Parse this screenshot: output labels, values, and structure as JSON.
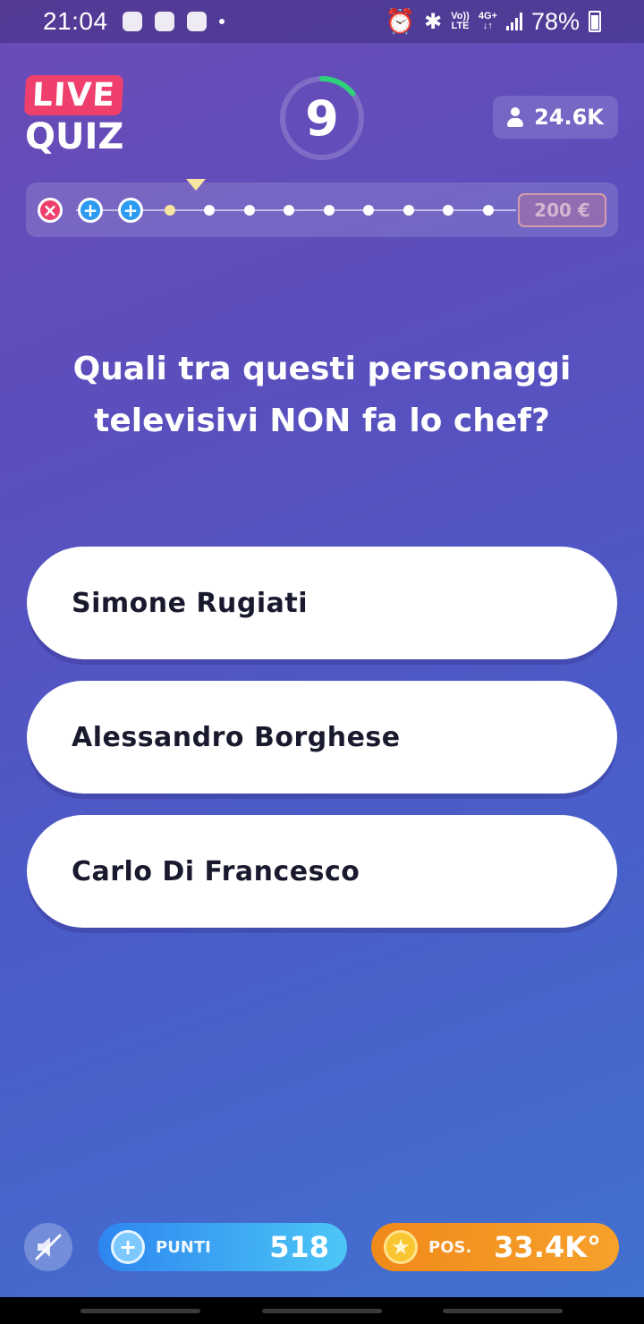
{
  "status_bar": {
    "time": "21:04",
    "volte_top": "Vo))",
    "volte_bottom": "LTE",
    "network_top": "4G+",
    "network_bottom": "↓↑",
    "battery": "78%"
  },
  "header": {
    "logo_live": "LIVE",
    "logo_quiz": "QUIZ",
    "timer_value": "9",
    "viewers": "24.6K"
  },
  "progress": {
    "prize": "200 €",
    "steps": [
      {
        "state": "wrong",
        "glyph": "×"
      },
      {
        "state": "extra-life",
        "glyph": "+"
      },
      {
        "state": "extra-life",
        "glyph": "+"
      },
      {
        "state": "current"
      },
      {
        "state": "pending"
      },
      {
        "state": "pending"
      },
      {
        "state": "pending"
      },
      {
        "state": "pending"
      },
      {
        "state": "pending"
      },
      {
        "state": "pending"
      },
      {
        "state": "pending"
      },
      {
        "state": "pending"
      }
    ]
  },
  "question": {
    "line1": "Quali tra questi personaggi",
    "line2": "televisivi NON fa lo chef?"
  },
  "answers": [
    {
      "label": "Simone Rugiati"
    },
    {
      "label": "Alessandro Borghese"
    },
    {
      "label": "Carlo Di Francesco"
    }
  ],
  "footer": {
    "points_label": "PUNTI",
    "points_value": "518",
    "position_label": "POS.",
    "position_value": "33.4K°"
  },
  "colors": {
    "accent_pink": "#ef3f6d",
    "timer_green": "#2fd17a",
    "points_blue": "#2d86f0",
    "position_orange": "#f08a1a"
  }
}
